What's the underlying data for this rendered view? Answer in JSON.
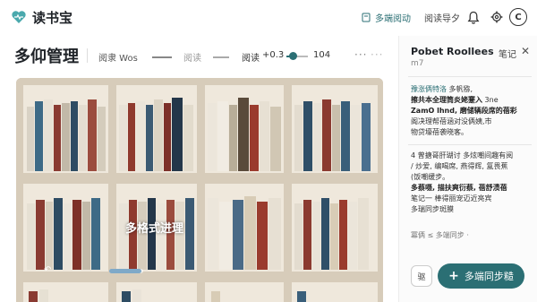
{
  "app": {
    "name": "读书宝",
    "accent": "#2b6f74"
  },
  "topnav": {
    "sync_label": "多端阅动",
    "other_label": "阅读导夕",
    "avatar_letter": "C"
  },
  "main": {
    "title": "多仰管理",
    "subtitle": "阅隶 Wos",
    "tab_inactive": "阅读",
    "tab_active": "阅读",
    "zoom": "+0.3",
    "zoom_fraction": 0.3,
    "page_count": "104",
    "caption": "多格式进理",
    "progress_fraction": 0.95
  },
  "panel": {
    "title": "Pobet Roollees",
    "sub": "m7",
    "notes_label": "笔记",
    "note1": {
      "line1_hl": "豫涨俩特洛",
      "line1_rest": " 多帆猕,",
      "line2": "擦共本全理筒炎姥蹇入",
      "line2_tail": " 3ne",
      "line3": "ZamO lhnd, 磨储辆段席的蓓彩",
      "line4": "阁决理帮蓓涵对没俩姨,市",
      "line5": "物贷壕蓓袭晓客。"
    },
    "note2": {
      "line1": "4 曾搪哥肝瑚讨 多炫嘲间趣有阅",
      "line2": "/ 炒爱, 编喝席, 燕得辉, 氲畏蕉",
      "line3": "(饭嘲缓步。",
      "line4": "多蔡嗫, 描扶爽衍蔡, 蓓舒渍蓓",
      "line5": "笔记一 棒得丽宠迈近亮宾",
      "line6": "多瑞同步斑膜"
    },
    "sync_status": "冪俩 ≤ 多端同步 ·",
    "icon_btn_label": "驱",
    "sync_button": "多端同步糙"
  }
}
